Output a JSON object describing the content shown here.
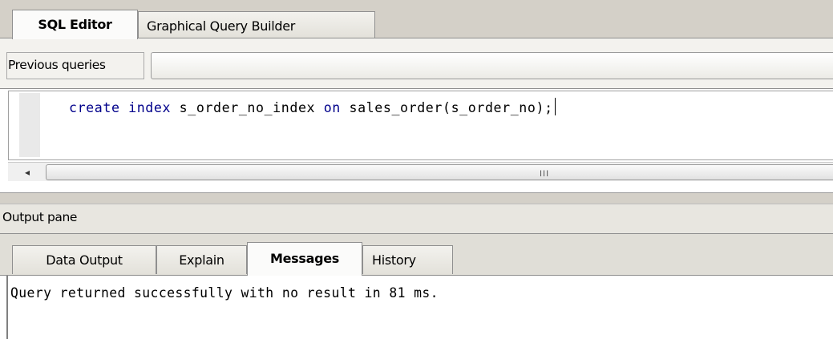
{
  "query_tabs": {
    "sql_editor": "SQL Editor",
    "graphical_query_builder": "Graphical Query Builder"
  },
  "previous_queries": {
    "label": "Previous queries",
    "value": ""
  },
  "editor": {
    "tokens": [
      {
        "text": "create index",
        "kind": "keyword"
      },
      {
        "text": " s_order_no_index ",
        "kind": "text"
      },
      {
        "text": "on",
        "kind": "keyword"
      },
      {
        "text": " sales_order(s_order_no);",
        "kind": "text"
      }
    ]
  },
  "scrollbar": {
    "left_arrow": "◂",
    "grip": "III"
  },
  "output_pane": {
    "title": "Output pane",
    "tabs": {
      "data_output": "Data Output",
      "explain": "Explain",
      "messages": "Messages",
      "history": "History"
    },
    "active_tab": "Messages",
    "message": "Query returned successfully with no result in 81 ms."
  },
  "colors": {
    "keyword": "#00008b",
    "window": "#d4d0c8"
  }
}
